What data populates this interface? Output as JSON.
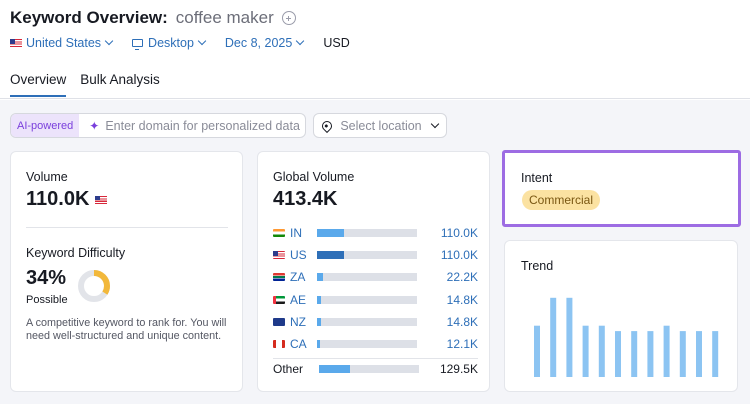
{
  "header": {
    "title": "Keyword Overview:",
    "keyword": "coffee maker"
  },
  "filters": {
    "country": "United States",
    "device": "Desktop",
    "date": "Dec 8, 2025",
    "currency": "USD"
  },
  "tabs": [
    {
      "label": "Overview",
      "active": true
    },
    {
      "label": "Bulk Analysis",
      "active": false
    }
  ],
  "ai": {
    "badge": "AI-powered",
    "placeholder": "Enter domain for personalized data",
    "location_placeholder": "Select location"
  },
  "volume": {
    "label": "Volume",
    "value": "110.0K"
  },
  "keyword_difficulty": {
    "label": "Keyword Difficulty",
    "value": "34%",
    "level": "Possible",
    "percent": 34,
    "color": "#f2b83b",
    "description": "A competitive keyword to rank for. You will need well-structured and unique content."
  },
  "global_volume": {
    "label": "Global Volume",
    "value": "413.4K",
    "countries": [
      {
        "code": "IN",
        "value": "110.0K",
        "share": 0.27
      },
      {
        "code": "US",
        "value": "110.0K",
        "share": 0.27
      },
      {
        "code": "ZA",
        "value": "22.2K",
        "share": 0.06
      },
      {
        "code": "AE",
        "value": "14.8K",
        "share": 0.04
      },
      {
        "code": "NZ",
        "value": "14.8K",
        "share": 0.04
      },
      {
        "code": "CA",
        "value": "12.1K",
        "share": 0.03
      }
    ],
    "other": {
      "label": "Other",
      "value": "129.5K",
      "share": 0.31
    }
  },
  "intent": {
    "label": "Intent",
    "value": "Commercial"
  },
  "trend": {
    "label": "Trend"
  },
  "chart_data": {
    "type": "bar",
    "title": "Trend",
    "xlabel": "",
    "ylabel": "",
    "values": [
      0.57,
      0.88,
      0.88,
      0.57,
      0.57,
      0.51,
      0.51,
      0.51,
      0.57,
      0.51,
      0.51,
      0.51
    ],
    "ylim": [
      0,
      1
    ],
    "color": "#8cc4f2"
  }
}
